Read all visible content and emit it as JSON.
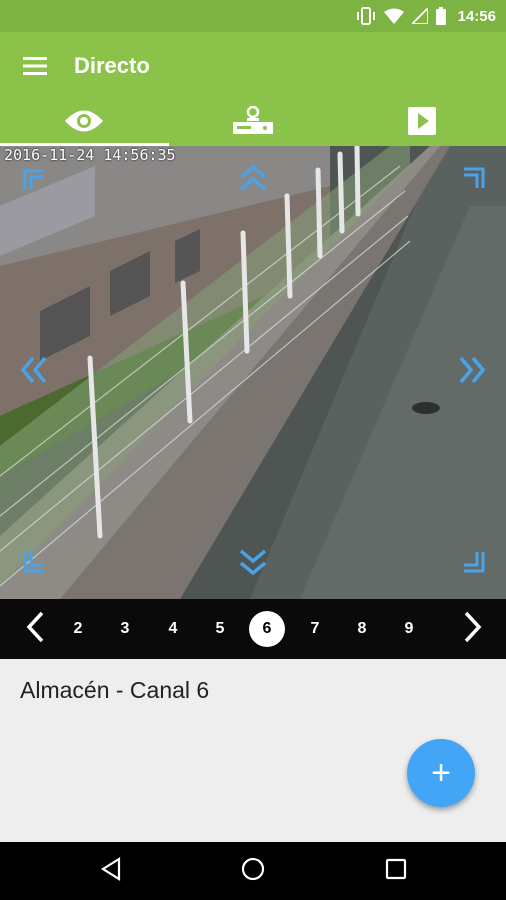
{
  "status_bar": {
    "time": "14:56",
    "icons": [
      "vibrate-icon",
      "wifi-icon",
      "signal-icon",
      "battery-icon"
    ]
  },
  "app_bar": {
    "title": "Directo",
    "menu_icon": "hamburger-menu-icon"
  },
  "tabs": [
    {
      "name": "live",
      "icon": "eye-icon",
      "active": true
    },
    {
      "name": "recorder",
      "icon": "dvr-icon",
      "active": false
    },
    {
      "name": "playback",
      "icon": "play-icon",
      "active": false
    }
  ],
  "video": {
    "timestamp": "2016-11-24 14:56:35",
    "ptz_controls": [
      "up-left",
      "up",
      "up-right",
      "left",
      "right",
      "down-left",
      "down",
      "down-right"
    ]
  },
  "channel_bar": {
    "channels": [
      "2",
      "3",
      "4",
      "5",
      "6",
      "7",
      "8",
      "9"
    ],
    "selected": "6"
  },
  "info": {
    "camera_name": "Almacén - Canal 6",
    "fab_label": "+"
  },
  "colors": {
    "primary": "#8bc34a",
    "status_bar": "#7cb342",
    "accent": "#42a5f5",
    "ptz_arrows": "#4aa3e8"
  }
}
